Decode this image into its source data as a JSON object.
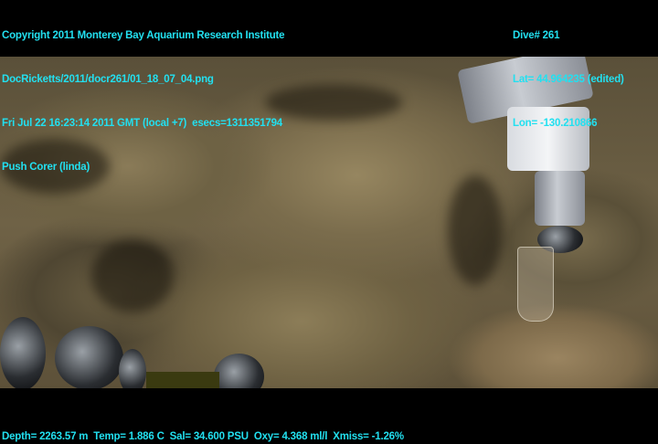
{
  "header_left": {
    "line1": "Copyright 2011 Monterey Bay Aquarium Research Institute",
    "line2": "DocRicketts/2011/docr261/01_18_07_04.png",
    "line3": "Fri Jul 22 16:23:14 2011 GMT (local +7)  esecs=1311351794",
    "line4": "Push Corer (linda)"
  },
  "header_right": {
    "dive": "Dive# 261",
    "lat": "Lat= 44.964235 (edited)",
    "lon": "Lon= -130.210866"
  },
  "footer": {
    "telemetry": "Depth= 2263.57 m  Temp= 1.886 C  Sal= 34.600 PSU  Oxy= 4.368 ml/l  Xmiss= -1.26%"
  },
  "colors": {
    "overlay_text": "#22e0f0",
    "background": "#000000"
  }
}
